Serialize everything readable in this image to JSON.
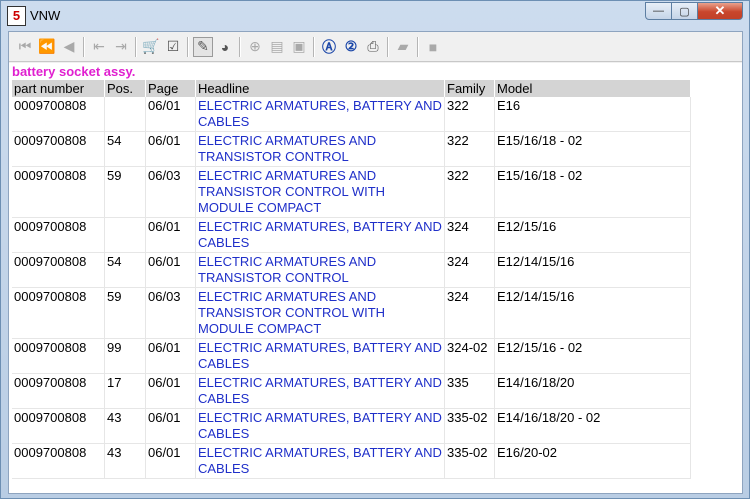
{
  "window": {
    "title": "VNW",
    "icon_letter": "5"
  },
  "window_buttons": {
    "minimize": "—",
    "maximize": "▢",
    "close": "✕"
  },
  "toolbar": [
    {
      "name": "first-icon",
      "glyph": "⏮",
      "state": "dim"
    },
    {
      "name": "prev-fast-icon",
      "glyph": "⏪",
      "state": "dim"
    },
    {
      "name": "prev-icon",
      "glyph": "◀",
      "state": "dim"
    },
    {
      "sep": true
    },
    {
      "name": "bookmark-back-icon",
      "glyph": "⇤",
      "state": "dim"
    },
    {
      "name": "bookmark-forward-icon",
      "glyph": "⇥",
      "state": "dim"
    },
    {
      "sep": true
    },
    {
      "name": "cart-icon",
      "glyph": "🛒",
      "state": "normal"
    },
    {
      "name": "checklist-icon",
      "glyph": "☑",
      "state": "normal"
    },
    {
      "sep": true
    },
    {
      "name": "pencil-icon",
      "glyph": "✎",
      "state": "active"
    },
    {
      "name": "globe-icon",
      "glyph": "◕",
      "state": "normal"
    },
    {
      "sep": true
    },
    {
      "name": "zoom-icon",
      "glyph": "⊕",
      "state": "dim"
    },
    {
      "name": "page-icon",
      "glyph": "▤",
      "state": "dim"
    },
    {
      "name": "page-p-icon",
      "glyph": "▣",
      "state": "dim"
    },
    {
      "sep": true
    },
    {
      "name": "search-a-icon",
      "glyph": "Ⓐ",
      "state": "blue"
    },
    {
      "name": "search-2-icon",
      "glyph": "②",
      "state": "blue"
    },
    {
      "name": "print-icon",
      "glyph": "⎙",
      "state": "normal"
    },
    {
      "sep": true
    },
    {
      "name": "note-icon",
      "glyph": "▰",
      "state": "dim"
    },
    {
      "sep": true
    },
    {
      "name": "stop-icon",
      "glyph": "■",
      "state": "dim"
    }
  ],
  "heading": "battery socket assy.",
  "table": {
    "columns": [
      "part number",
      "Pos.",
      "Page",
      "Headline",
      "Family",
      "Model"
    ],
    "rows": [
      [
        "0009700808",
        "",
        "06/01",
        "ELECTRIC ARMATURES, BATTERY AND CABLES",
        "322",
        "E16"
      ],
      [
        "0009700808",
        "54",
        "06/01",
        "ELECTRIC ARMATURES AND TRANSISTOR CONTROL",
        "322",
        "E15/16/18 - 02"
      ],
      [
        "0009700808",
        "59",
        "06/03",
        "ELECTRIC ARMATURES AND TRANSISTOR CONTROL WITH MODULE COMPACT",
        "322",
        "E15/16/18 - 02"
      ],
      [
        "0009700808",
        "",
        "06/01",
        "ELECTRIC ARMATURES, BATTERY AND CABLES",
        "324",
        "E12/15/16"
      ],
      [
        "0009700808",
        "54",
        "06/01",
        "ELECTRIC ARMATURES AND TRANSISTOR CONTROL",
        "324",
        "E12/14/15/16"
      ],
      [
        "0009700808",
        "59",
        "06/03",
        "ELECTRIC ARMATURES AND TRANSISTOR CONTROL WITH MODULE COMPACT",
        "324",
        "E12/14/15/16"
      ],
      [
        "0009700808",
        "99",
        "06/01",
        "ELECTRIC ARMATURES, BATTERY AND CABLES",
        "324-02",
        "E12/15/16 - 02"
      ],
      [
        "0009700808",
        "17",
        "06/01",
        "ELECTRIC ARMATURES, BATTERY AND CABLES",
        "335",
        "E14/16/18/20"
      ],
      [
        "0009700808",
        "43",
        "06/01",
        "ELECTRIC ARMATURES, BATTERY AND CABLES",
        "335-02",
        "E14/16/18/20 - 02"
      ],
      [
        "0009700808",
        "43",
        "06/01",
        "ELECTRIC ARMATURES, BATTERY AND CABLES",
        "335-02",
        "E16/20-02"
      ]
    ]
  },
  "colors": {
    "heading": "#e020d0",
    "headline_link": "#1f2fc9"
  }
}
